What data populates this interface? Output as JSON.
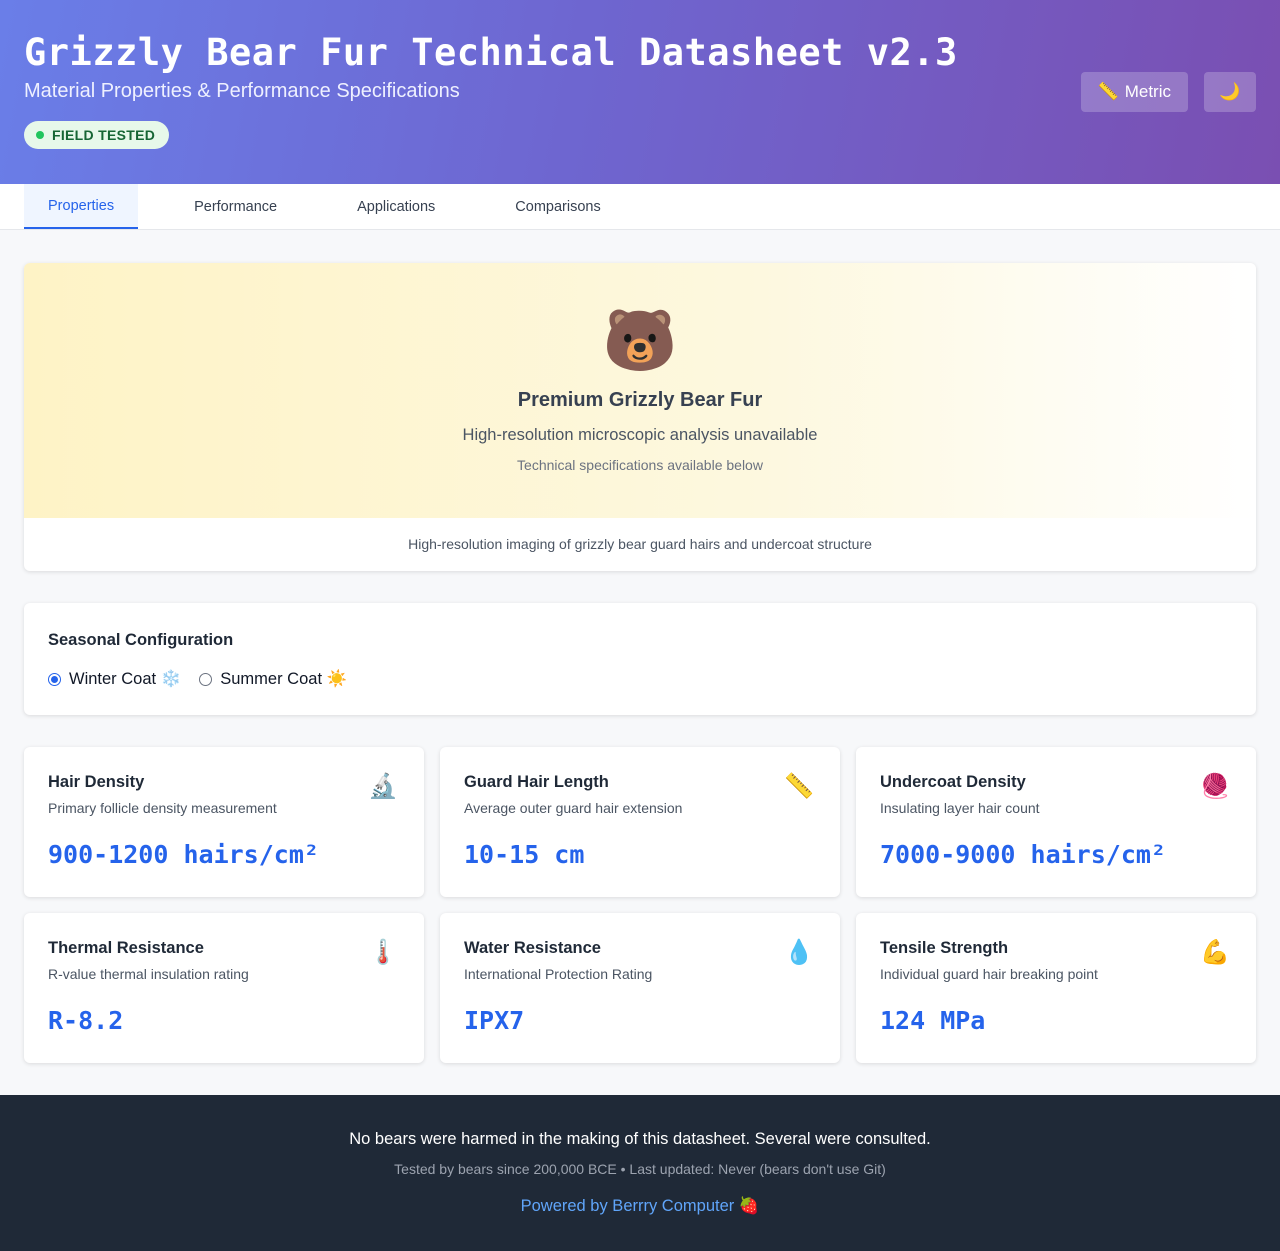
{
  "header": {
    "title": "Grizzly Bear Fur Technical Datasheet v2.3",
    "subtitle": "Material Properties & Performance Specifications",
    "badge": "FIELD TESTED",
    "units_icon": "📏",
    "units_label": "Metric",
    "theme_icon": "🌙"
  },
  "tabs": [
    "Properties",
    "Performance",
    "Applications",
    "Comparisons"
  ],
  "hero": {
    "icon": "🐻",
    "title": "Premium Grizzly Bear Fur",
    "subtitle": "High-resolution microscopic analysis unavailable",
    "note": "Technical specifications available below",
    "caption": "High-resolution imaging of grizzly bear guard hairs and undercoat structure"
  },
  "season": {
    "title": "Seasonal Configuration",
    "options": [
      "Winter Coat ❄️",
      "Summer Coat ☀️"
    ],
    "selected": "Winter Coat ❄️"
  },
  "specs": [
    {
      "name": "Hair Density",
      "desc": "Primary follicle density measurement",
      "value": "900-1200 hairs/cm²",
      "icon": "🔬"
    },
    {
      "name": "Guard Hair Length",
      "desc": "Average outer guard hair extension",
      "value": "10-15 cm",
      "icon": "📏"
    },
    {
      "name": "Undercoat Density",
      "desc": "Insulating layer hair count",
      "value": "7000-9000 hairs/cm²",
      "icon": "🧶"
    },
    {
      "name": "Thermal Resistance",
      "desc": "R-value thermal insulation rating",
      "value": "R-8.2",
      "icon": "🌡️"
    },
    {
      "name": "Water Resistance",
      "desc": "International Protection Rating",
      "value": "IPX7",
      "icon": "💧"
    },
    {
      "name": "Tensile Strength",
      "desc": "Individual guard hair breaking point",
      "value": "124 MPa",
      "icon": "💪"
    }
  ],
  "footer": {
    "main": "No bears were harmed in the making of this datasheet. Several were consulted.",
    "sub": "Tested by bears since 200,000 BCE • Last updated: Never (bears don't use Git)",
    "link": "Powered by Berrry Computer 🍓"
  },
  "colors": {
    "accent": "#2563eb",
    "header_start": "#6a7ee8",
    "header_end": "#7a4fb2",
    "badge_bg": "#e7f8ea",
    "footer_bg": "#1f2937"
  }
}
